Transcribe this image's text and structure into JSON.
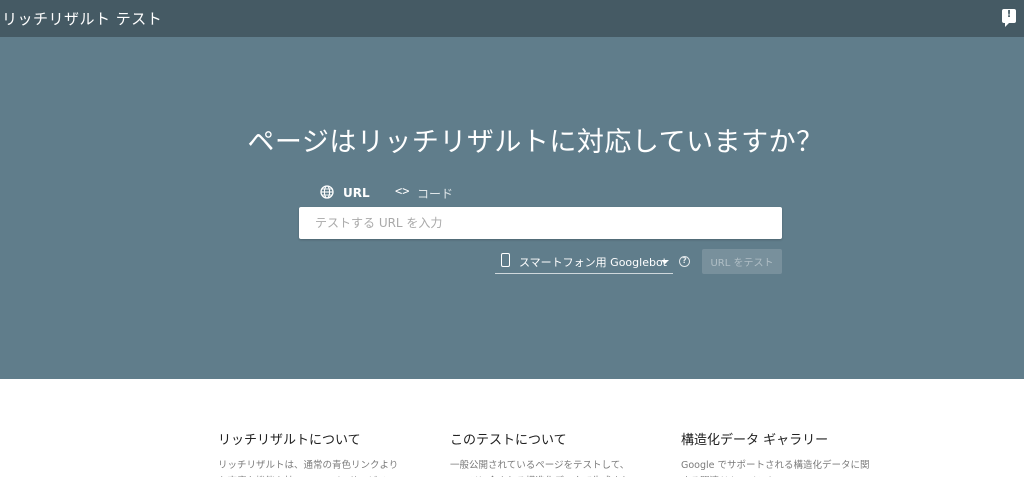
{
  "app": {
    "title": "リッチリザルト テスト",
    "feedback_icon": "feedback-icon"
  },
  "hero": {
    "headline": "ページはリッチリザルトに対応していますか？",
    "tabs": [
      {
        "label": "URL",
        "icon": "globe-icon",
        "active": true
      },
      {
        "label": "コード",
        "icon": "code-icon",
        "active": false
      }
    ],
    "url_input": {
      "placeholder": "テストする URL を入力",
      "value": ""
    },
    "device_select": {
      "selected": "スマートフォン用 Googlebot",
      "icon": "smartphone-icon"
    },
    "help_icon": "help-icon",
    "test_button": "URL をテスト"
  },
  "info": [
    {
      "title": "リッチリザルトについて",
      "text": "リッチリザルトは、通常の青色リンクより\nも高度な機能を持つ、Google サービス"
    },
    {
      "title": "このテストについて",
      "text": "一般公開されているページをテストして、\nページに含まれる構造化データで生成され"
    },
    {
      "title": "構造化データ ギャラリー",
      "text": "Google でサポートされる構造化データに関\nする関連ドキュメント"
    }
  ],
  "colors": {
    "topbar": "#455a64",
    "hero": "#607d8b",
    "accent": "#f4a100"
  }
}
